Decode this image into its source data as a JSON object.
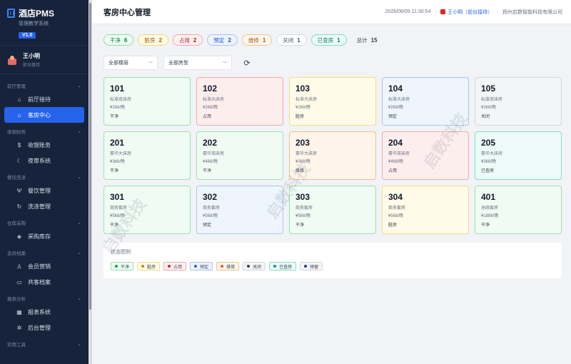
{
  "brand": {
    "title": "酒店PMS",
    "subtitle": "管理教学系统",
    "version": "V1.0"
  },
  "user": {
    "name": "王小明",
    "role": "前台接待"
  },
  "nav": [
    {
      "group": "前厅管理",
      "items": [
        {
          "label": "前厅接待",
          "icon": "bed-icon",
          "glyph": "⌂",
          "active": false
        },
        {
          "label": "客房中心",
          "icon": "home-icon",
          "glyph": "⌂",
          "active": true
        }
      ]
    },
    {
      "group": "收银财务",
      "items": [
        {
          "label": "收银账务",
          "icon": "dollar-icon",
          "glyph": "$",
          "active": false
        },
        {
          "label": "夜审系统",
          "icon": "moon-icon",
          "glyph": "☾",
          "active": false
        }
      ]
    },
    {
      "group": "餐饮洗涤",
      "items": [
        {
          "label": "餐饮管理",
          "icon": "fork-knife-icon",
          "glyph": "Ψ",
          "active": false
        },
        {
          "label": "洗涤管理",
          "icon": "washing-icon",
          "glyph": "↻",
          "active": false
        }
      ]
    },
    {
      "group": "仓库采购",
      "items": [
        {
          "label": "采购库存",
          "icon": "box-icon",
          "glyph": "◈",
          "active": false
        }
      ]
    },
    {
      "group": "会员档案",
      "items": [
        {
          "label": "会员营销",
          "icon": "users-icon",
          "glyph": "♙",
          "active": false
        },
        {
          "label": "共客档案",
          "icon": "book-icon",
          "glyph": "▭",
          "active": false
        }
      ]
    },
    {
      "group": "报表分析",
      "items": [
        {
          "label": "报表系统",
          "icon": "chart-icon",
          "glyph": "▦",
          "active": false
        },
        {
          "label": "后台管理",
          "icon": "gear-icon",
          "glyph": "✲",
          "active": false
        }
      ]
    },
    {
      "group": "实用工具",
      "items": []
    }
  ],
  "header": {
    "title": "客房中心管理",
    "datetime": "2026/06/09 11:30:54",
    "user_link": "王小明（前台接待）",
    "company": "扬州启数智能科技有限公司"
  },
  "stats": [
    {
      "label": "干净",
      "count": "6",
      "bg": "#ecfdf3",
      "border": "#86e0ab",
      "color": "#15803d"
    },
    {
      "label": "脏房",
      "count": "2",
      "bg": "#fffbe6",
      "border": "#f2d776",
      "color": "#a16207"
    },
    {
      "label": "占用",
      "count": "2",
      "bg": "#fff1f1",
      "border": "#f5a3a3",
      "color": "#b91c1c"
    },
    {
      "label": "预定",
      "count": "2",
      "bg": "#eef4ff",
      "border": "#a7c1f2",
      "color": "#1d4ed8"
    },
    {
      "label": "维修",
      "count": "1",
      "bg": "#fff7ec",
      "border": "#f4c38a",
      "color": "#b45309"
    },
    {
      "label": "关闭",
      "count": "1",
      "bg": "#ffffff",
      "border": "#d6d9de",
      "color": "#4b5563"
    },
    {
      "label": "已查房",
      "count": "1",
      "bg": "#ecfdf7",
      "border": "#7fdcc7",
      "color": "#0f766e"
    },
    {
      "label": "总计",
      "count": "15",
      "bg": "transparent",
      "border": "transparent",
      "color": "#374151"
    }
  ],
  "filters": {
    "floor": "全部楼层",
    "status": "全部房型"
  },
  "rooms": [
    {
      "num": "101",
      "type": "标准双床房",
      "price": "¥268/晚",
      "status": "干净",
      "bg": "#effbf3",
      "border": "#9ee0b5"
    },
    {
      "num": "102",
      "type": "标准大床房",
      "price": "¥268/晚",
      "status": "占用",
      "bg": "#fdeeee",
      "border": "#f1aaaa"
    },
    {
      "num": "103",
      "type": "标准大床房",
      "price": "¥268/晚",
      "status": "脏房",
      "bg": "#fffbe8",
      "border": "#f2dc87"
    },
    {
      "num": "104",
      "type": "标准大床房",
      "price": "¥268/晚",
      "status": "预定",
      "bg": "#eef5fd",
      "border": "#a9c5ee"
    },
    {
      "num": "105",
      "type": "标准双床房",
      "price": "¥268/晚",
      "status": "关闭",
      "bg": "#f4f5f7",
      "border": "#d3d6db"
    },
    {
      "num": "201",
      "type": "豪华大床房",
      "price": "¥368/晚",
      "status": "干净",
      "bg": "#effbf3",
      "border": "#9ee0b5"
    },
    {
      "num": "202",
      "type": "豪华双床房",
      "price": "¥468/晚",
      "status": "干净",
      "bg": "#effbf3",
      "border": "#9ee0b5"
    },
    {
      "num": "203",
      "type": "豪华大床房",
      "price": "¥368/晚",
      "status": "维修",
      "bg": "#fff5ea",
      "border": "#f1c089"
    },
    {
      "num": "204",
      "type": "豪华双床房",
      "price": "¥468/晚",
      "status": "占用",
      "bg": "#fdeeee",
      "border": "#f1aaaa"
    },
    {
      "num": "205",
      "type": "豪华大床房",
      "price": "¥368/晚",
      "status": "已查房",
      "bg": "#ecfbf7",
      "border": "#84dcc9"
    },
    {
      "num": "301",
      "type": "商务套房",
      "price": "¥568/晚",
      "status": "干净",
      "bg": "#effbf3",
      "border": "#9ee0b5"
    },
    {
      "num": "302",
      "type": "商务套房",
      "price": "¥568/晚",
      "status": "预定",
      "bg": "#eef5fd",
      "border": "#a9c5ee"
    },
    {
      "num": "303",
      "type": "商务套房",
      "price": "¥568/晚",
      "status": "干净",
      "bg": "#effbf3",
      "border": "#9ee0b5"
    },
    {
      "num": "304",
      "type": "商务套房",
      "price": "¥568/晚",
      "status": "脏房",
      "bg": "#fffbe8",
      "border": "#f2dc87"
    },
    {
      "num": "401",
      "type": "总统套房",
      "price": "¥1888/晚",
      "status": "干净",
      "bg": "#effbf3",
      "border": "#9ee0b5"
    }
  ],
  "legend": {
    "title": "状态图例",
    "items": [
      {
        "label": "干净",
        "dot": "#16a34a",
        "bg": "#ecfdf3",
        "border": "#9ee0b5"
      },
      {
        "label": "脏房",
        "dot": "#ca8a04",
        "bg": "#fffbe6",
        "border": "#f2dc87"
      },
      {
        "label": "占用",
        "dot": "#dc2626",
        "bg": "#fff1f1",
        "border": "#f1aaaa"
      },
      {
        "label": "预定",
        "dot": "#2563eb",
        "bg": "#eef4ff",
        "border": "#a9c5ee"
      },
      {
        "label": "维修",
        "dot": "#ea580c",
        "bg": "#fff7ec",
        "border": "#f1c089"
      },
      {
        "label": "关闭",
        "dot": "#374151",
        "bg": "#f4f5f7",
        "border": "#d3d6db"
      },
      {
        "label": "已查房",
        "dot": "#0d9488",
        "bg": "#ecfbf7",
        "border": "#84dcc9"
      },
      {
        "label": "预留",
        "dot": "#1e3a8a",
        "bg": "#f3f4f6",
        "border": "#d3d6db"
      }
    ]
  },
  "watermark": "启数科技"
}
